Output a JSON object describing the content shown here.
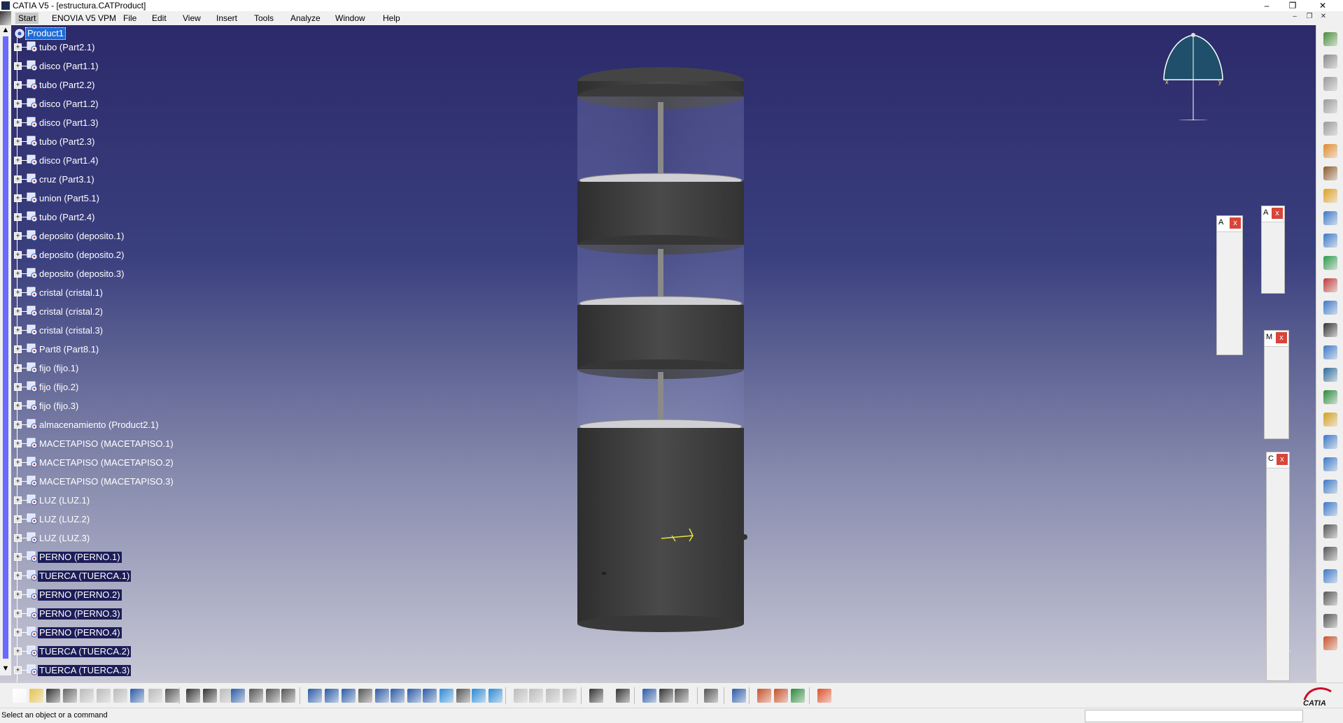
{
  "window": {
    "title": "CATIA V5 - [estructura.CATProduct]",
    "minimize": "–",
    "restore": "❐",
    "close": "✕"
  },
  "menu": {
    "items": [
      "Start",
      "ENOVIA V5 VPM",
      "File",
      "Edit",
      "View",
      "Insert",
      "Tools",
      "Analyze",
      "Window",
      "Help"
    ],
    "mdi_minimize": "–",
    "mdi_restore": "❐",
    "mdi_close": "✕"
  },
  "tree": {
    "root": "Product1",
    "nodes": [
      "tubo (Part2.1)",
      "disco (Part1.1)",
      "tubo (Part2.2)",
      "disco (Part1.2)",
      "disco (Part1.3)",
      "tubo (Part2.3)",
      "disco (Part1.4)",
      "cruz (Part3.1)",
      "union (Part5.1)",
      "tubo (Part2.4)",
      "deposito (deposito.1)",
      "deposito (deposito.2)",
      "deposito (deposito.3)",
      "cristal (cristal.1)",
      "cristal (cristal.2)",
      "cristal (cristal.3)",
      "Part8 (Part8.1)",
      "fijo (fijo.1)",
      "fijo (fijo.2)",
      "fijo (fijo.3)",
      "almacenamiento (Product2.1)",
      "MACETAPISO (MACETAPISO.1)",
      "MACETAPISO (MACETAPISO.2)",
      "MACETAPISO (MACETAPISO.3)",
      "LUZ (LUZ.1)",
      "LUZ (LUZ.2)",
      "LUZ (LUZ.3)",
      "PERNO (PERNO.1)",
      "TUERCA (TUERCA.1)",
      "PERNO (PERNO.2)",
      "PERNO (PERNO.3)",
      "PERNO (PERNO.4)",
      "TUERCA (TUERCA.2)",
      "TUERCA (TUERCA.3)"
    ],
    "highlighted_from_index": 27,
    "scroll_up": "▲",
    "scroll_down": "▼"
  },
  "floating_toolbars": [
    {
      "letter": "A",
      "close": "x"
    },
    {
      "letter": "A",
      "close": "x"
    },
    {
      "letter": "M",
      "close": "x"
    },
    {
      "letter": "C",
      "close": "x"
    }
  ],
  "compass": {
    "axis_x": "x",
    "axis_y": "y"
  },
  "axis_label_bottom_right": "y",
  "brand": "CATIA",
  "status": {
    "message": "Select an object or a command"
  },
  "colors": {
    "viewport_top": "#2c2a6a",
    "viewport_bottom": "#c8c8d6",
    "selection": "#1f6bd6",
    "highlight": "#1c1d58",
    "model_gray": "#3d3d3d",
    "close_red": "#d7453b"
  }
}
